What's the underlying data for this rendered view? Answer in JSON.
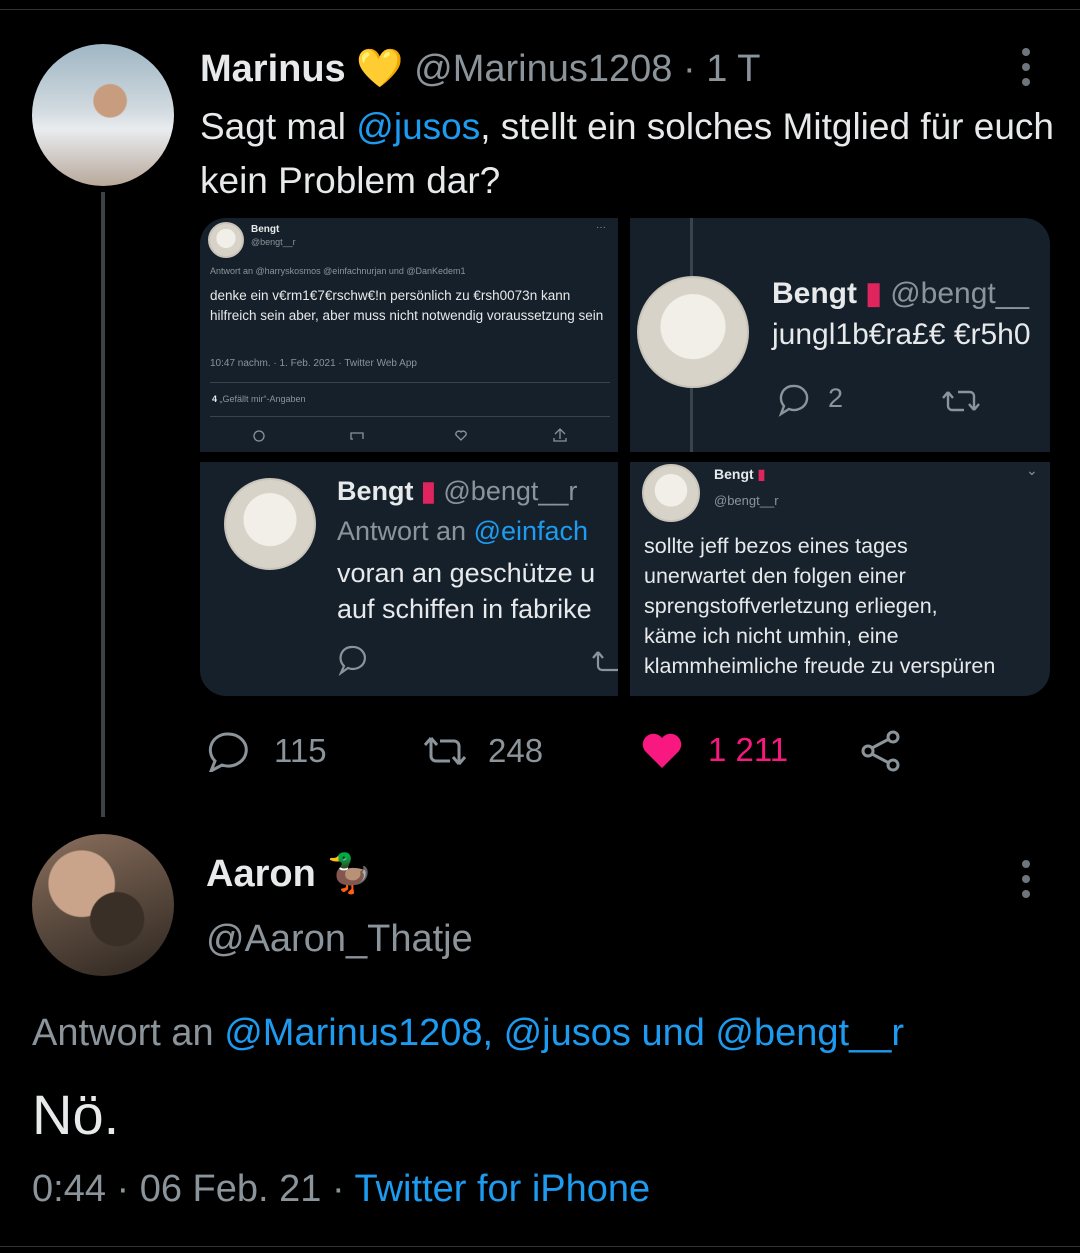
{
  "tweet1": {
    "name": "Marinus",
    "emoji": "💛",
    "handle": "@Marinus1208",
    "time": "· 1 T",
    "text_before": "Sagt mal ",
    "mention": "@jusos",
    "text_after": ", stellt ein solches Mitglied für euch kein Problem dar?",
    "counts": {
      "replies": "115",
      "retweets": "248",
      "likes": "1 211"
    }
  },
  "img1": {
    "name": "Bengt",
    "handle": "@bengt__r",
    "reply_to": "Antwort an @harryskosmos @einfachnurjan und @DanKedem1",
    "text": "denke ein v€rm1€7€rschw€!n persönlich zu €rsh0073n kann hilfreich sein aber, aber muss nicht notwendig voraussetzung sein",
    "meta": "10:47 nachm. · 1. Feb. 2021 · Twitter Web App",
    "likes": "4",
    "likes_label": "„Gefällt mir“-Angaben"
  },
  "img2": {
    "name": "Bengt",
    "handle": "@bengt__",
    "text": "jungl1b€ra£€ €r5h0",
    "replies": "2"
  },
  "img3": {
    "name": "Bengt",
    "handle": "@bengt__r",
    "reply_prefix": "Antwort an ",
    "reply_handle": "@einfach",
    "line1": "voran an geschütze u",
    "line2": "auf schiffen in fabrike"
  },
  "img4": {
    "name": "Bengt",
    "handle": "@bengt__r",
    "text_lines": [
      "sollte jeff bezos eines tages",
      "unerwartet den folgen einer",
      "sprengstoffverletzung erliegen,",
      "käme ich nicht umhin, eine",
      "klammheimliche freude zu verspüren"
    ]
  },
  "tweet2": {
    "name": "Aaron",
    "emoji": "🦆",
    "handle": "@Aaron_Thatje",
    "reply_prefix": "Antwort an ",
    "reply_to": "@Marinus1208, @jusos und @bengt__r",
    "text": "Nö.",
    "time": "0:44 · 06 Feb. 21 · ",
    "source": "Twitter for iPhone"
  },
  "colors": {
    "link": "#1d9bf0",
    "like": "#f91880",
    "muted": "#8b949a"
  }
}
